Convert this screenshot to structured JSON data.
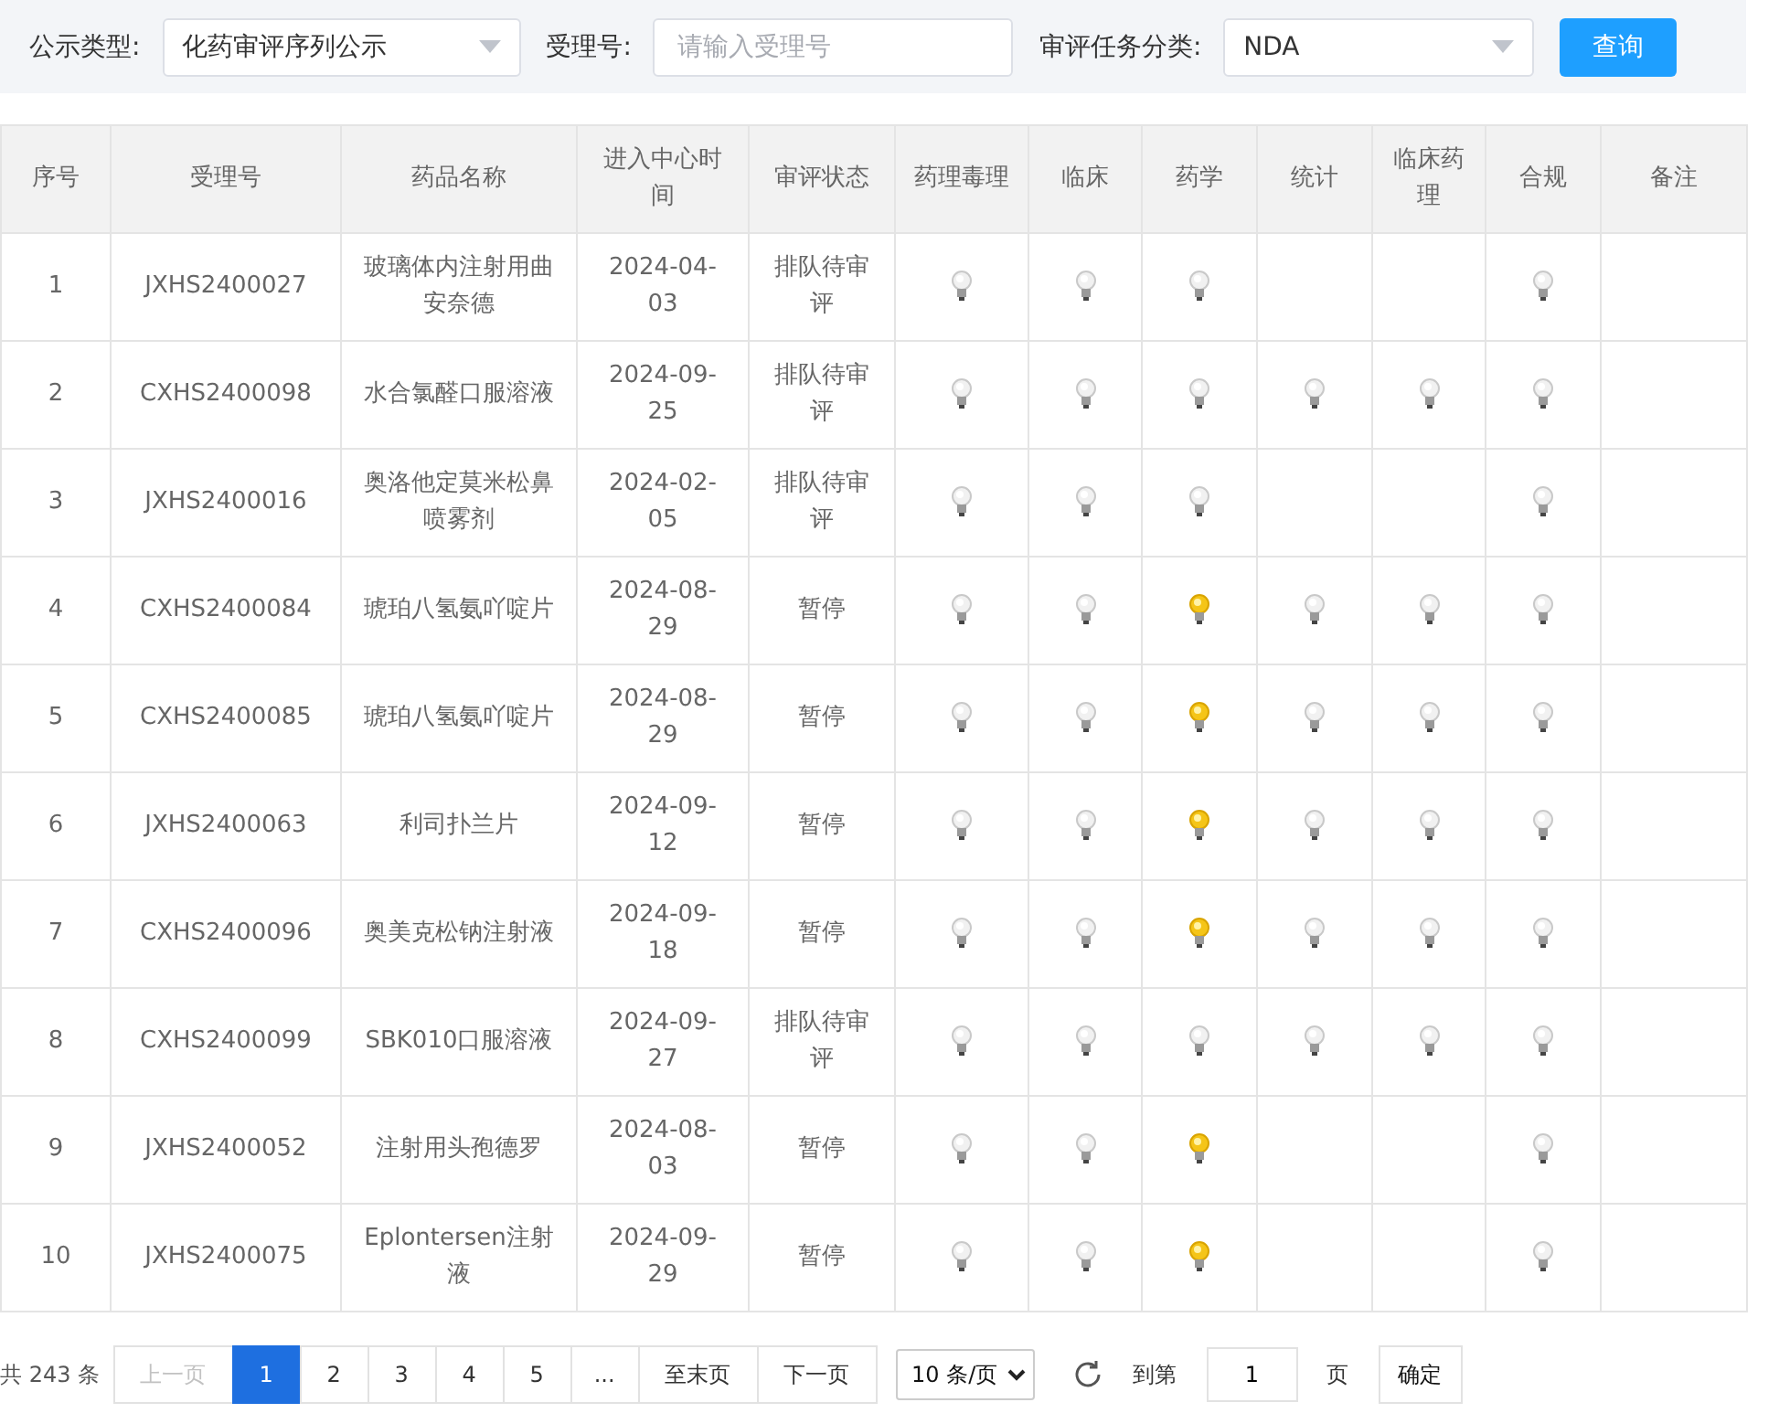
{
  "filters": [
    {
      "label": "公示类型:",
      "kind": "select",
      "value": "化药审评序列公示"
    },
    {
      "label": "受理号:",
      "kind": "input",
      "placeholder": "请输入受理号"
    },
    {
      "label": "审评任务分类:",
      "kind": "select",
      "value": "NDA"
    }
  ],
  "search_button": "查询",
  "table": {
    "columns": [
      "序号",
      "受理号",
      "药品名称",
      "进入中心时间",
      "审评状态",
      "药理毒理",
      "临床",
      "药学",
      "统计",
      "临床药理",
      "合规",
      "备注"
    ],
    "rows": [
      {
        "no": "1",
        "id": "JXHS2400027",
        "name": "玻璃体内注射用曲安奈德",
        "date": "2024-04-03",
        "status": "排队待审评",
        "lamps": [
          {
            "kind": "bulb",
            "on": false
          },
          {
            "kind": "bulb",
            "on": false
          },
          {
            "kind": "bulb",
            "on": false
          },
          {
            "kind": "empty"
          },
          {
            "kind": "empty"
          },
          {
            "kind": "bulb",
            "on": false
          }
        ]
      },
      {
        "no": "2",
        "id": "CXHS2400098",
        "name": "水合氯醛口服溶液",
        "date": "2024-09-25",
        "status": "排队待审评",
        "lamps": [
          {
            "kind": "bulb",
            "on": false
          },
          {
            "kind": "bulb",
            "on": false
          },
          {
            "kind": "bulb",
            "on": false
          },
          {
            "kind": "bulb",
            "on": false
          },
          {
            "kind": "bulb",
            "on": false
          },
          {
            "kind": "bulb",
            "on": false
          }
        ]
      },
      {
        "no": "3",
        "id": "JXHS2400016",
        "name": "奥洛他定莫米松鼻喷雾剂",
        "date": "2024-02-05",
        "status": "排队待审评",
        "lamps": [
          {
            "kind": "bulb",
            "on": false
          },
          {
            "kind": "bulb",
            "on": false
          },
          {
            "kind": "bulb",
            "on": false
          },
          {
            "kind": "empty"
          },
          {
            "kind": "empty"
          },
          {
            "kind": "bulb",
            "on": false
          }
        ]
      },
      {
        "no": "4",
        "id": "CXHS2400084",
        "name": "琥珀八氢氨吖啶片",
        "date": "2024-08-29",
        "status": "暂停",
        "lamps": [
          {
            "kind": "bulb",
            "on": false
          },
          {
            "kind": "bulb",
            "on": false
          },
          {
            "kind": "bulb",
            "on": true
          },
          {
            "kind": "bulb",
            "on": false
          },
          {
            "kind": "bulb",
            "on": false
          },
          {
            "kind": "bulb",
            "on": false
          }
        ]
      },
      {
        "no": "5",
        "id": "CXHS2400085",
        "name": "琥珀八氢氨吖啶片",
        "date": "2024-08-29",
        "status": "暂停",
        "lamps": [
          {
            "kind": "bulb",
            "on": false
          },
          {
            "kind": "bulb",
            "on": false
          },
          {
            "kind": "bulb",
            "on": true
          },
          {
            "kind": "bulb",
            "on": false
          },
          {
            "kind": "bulb",
            "on": false
          },
          {
            "kind": "bulb",
            "on": false
          }
        ]
      },
      {
        "no": "6",
        "id": "JXHS2400063",
        "name": "利司扑兰片",
        "date": "2024-09-12",
        "status": "暂停",
        "lamps": [
          {
            "kind": "bulb",
            "on": false
          },
          {
            "kind": "bulb",
            "on": false
          },
          {
            "kind": "bulb",
            "on": true
          },
          {
            "kind": "bulb",
            "on": false
          },
          {
            "kind": "bulb",
            "on": false
          },
          {
            "kind": "bulb",
            "on": false
          }
        ]
      },
      {
        "no": "7",
        "id": "CXHS2400096",
        "name": "奥美克松钠注射液",
        "date": "2024-09-18",
        "status": "暂停",
        "lamps": [
          {
            "kind": "bulb",
            "on": false
          },
          {
            "kind": "bulb",
            "on": false
          },
          {
            "kind": "bulb",
            "on": true
          },
          {
            "kind": "bulb",
            "on": false
          },
          {
            "kind": "bulb",
            "on": false
          },
          {
            "kind": "bulb",
            "on": false
          }
        ]
      },
      {
        "no": "8",
        "id": "CXHS2400099",
        "name": "SBK010口服溶液",
        "date": "2024-09-27",
        "status": "排队待审评",
        "lamps": [
          {
            "kind": "bulb",
            "on": false
          },
          {
            "kind": "bulb",
            "on": false
          },
          {
            "kind": "bulb",
            "on": false
          },
          {
            "kind": "bulb",
            "on": false
          },
          {
            "kind": "bulb",
            "on": false
          },
          {
            "kind": "bulb",
            "on": false
          }
        ]
      },
      {
        "no": "9",
        "id": "JXHS2400052",
        "name": "注射用头孢德罗",
        "date": "2024-08-03",
        "status": "暂停",
        "lamps": [
          {
            "kind": "bulb",
            "on": false
          },
          {
            "kind": "bulb",
            "on": false
          },
          {
            "kind": "bulb",
            "on": true
          },
          {
            "kind": "empty"
          },
          {
            "kind": "empty"
          },
          {
            "kind": "bulb",
            "on": false
          }
        ]
      },
      {
        "no": "10",
        "id": "JXHS2400075",
        "name": "Eplontersen注射液",
        "date": "2024-09-29",
        "status": "暂停",
        "lamps": [
          {
            "kind": "bulb",
            "on": false
          },
          {
            "kind": "bulb",
            "on": false
          },
          {
            "kind": "bulb",
            "on": true
          },
          {
            "kind": "empty"
          },
          {
            "kind": "empty"
          },
          {
            "kind": "bulb",
            "on": false
          }
        ]
      }
    ]
  },
  "pagination": {
    "total": "共 243 条",
    "prev": {
      "label": "上一页",
      "disabled": true
    },
    "pages": [
      {
        "label": "1",
        "selected": true
      },
      {
        "label": "2",
        "selected": false
      },
      {
        "label": "3",
        "selected": false
      },
      {
        "label": "4",
        "selected": false
      },
      {
        "label": "5",
        "selected": false
      },
      {
        "label": "...",
        "selected": false
      }
    ],
    "last": "至末页",
    "next": "下一页",
    "page_size": "10 条/页",
    "goto_label": "到第",
    "goto_value": "1",
    "page_unit": "页",
    "confirm": "确定"
  }
}
